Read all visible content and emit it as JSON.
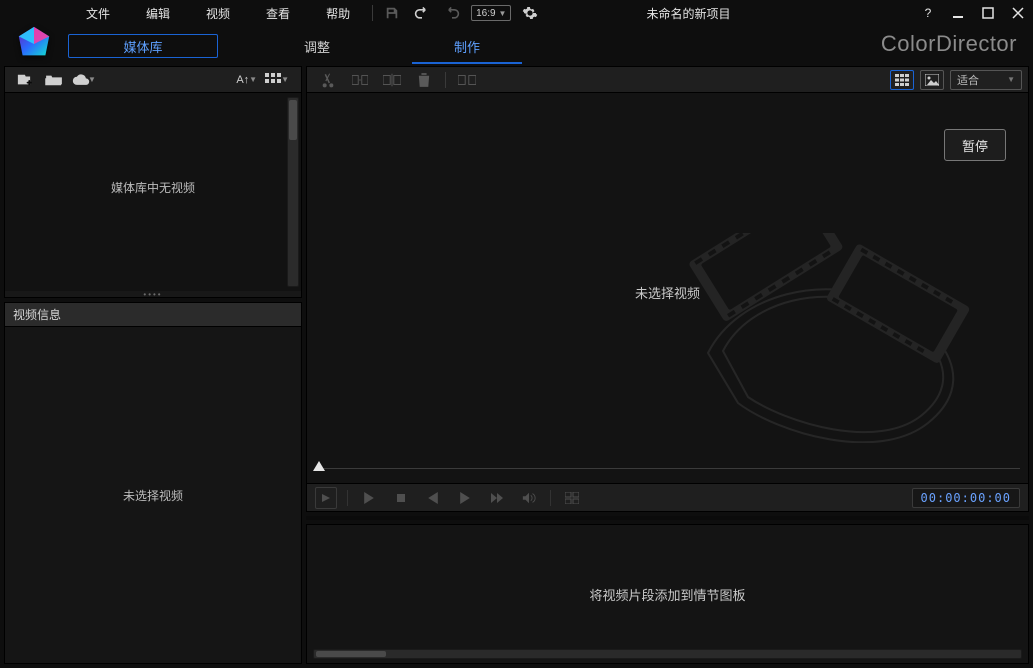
{
  "menubar": {
    "file": "文件",
    "edit": "编辑",
    "video": "视频",
    "view": "查看",
    "help": "帮助",
    "aspect": "16:9",
    "project_title": "未命名的新项目"
  },
  "tabs": {
    "library": "媒体库",
    "adjust": "调整",
    "produce": "制作"
  },
  "brand": "ColorDirector",
  "media": {
    "sort_label": "A↑",
    "empty_msg": "媒体库中无视频"
  },
  "video_info": {
    "header": "视频信息",
    "empty_msg": "未选择视频"
  },
  "preview": {
    "fit_label": "适合",
    "pause_label": "暂停",
    "no_video_msg": "未选择视频",
    "timecode": "00:00:00:00"
  },
  "storyboard": {
    "empty_msg": "将视频片段添加到情节图板"
  },
  "icons": {
    "grid": "grid",
    "compare": "compare"
  }
}
